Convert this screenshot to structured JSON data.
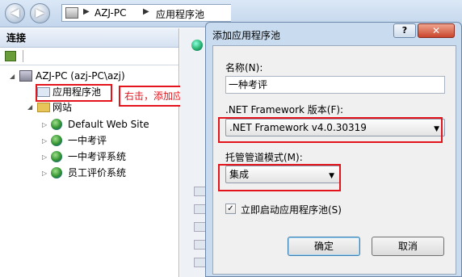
{
  "breadcrumb": {
    "host": "AZJ-PC",
    "page": "应用程序池",
    "arrow": "▶"
  },
  "left_panel": {
    "header": "连接"
  },
  "tree": {
    "root": "AZJ-PC (azj-PC\\azj)",
    "app_pools": "应用程序池",
    "sites": "网站",
    "site_items": [
      "Default Web Site",
      "一中考评",
      "一中考评系统",
      "员工评价系统"
    ]
  },
  "callout": "右击，添加应用程序池",
  "dialog": {
    "title": "添加应用程序池",
    "help": "?",
    "close": "✕",
    "name_label": "名称(N):",
    "name_value": "一种考评",
    "framework_label": ".NET Framework 版本(F):",
    "framework_value": ".NET Framework v4.0.30319",
    "pipeline_label": "托管管道模式(M):",
    "pipeline_value": "集成",
    "start_checkbox_label": "立即启动应用程序池(S)",
    "start_checked": true,
    "ok": "确定",
    "cancel": "取消"
  },
  "colors": {
    "highlight_red": "#e3141b",
    "dialog_frame": "#c9dbee"
  },
  "icons": {
    "back": "back-icon",
    "forward": "forward-icon",
    "dropdown": "chevron-down-icon"
  }
}
